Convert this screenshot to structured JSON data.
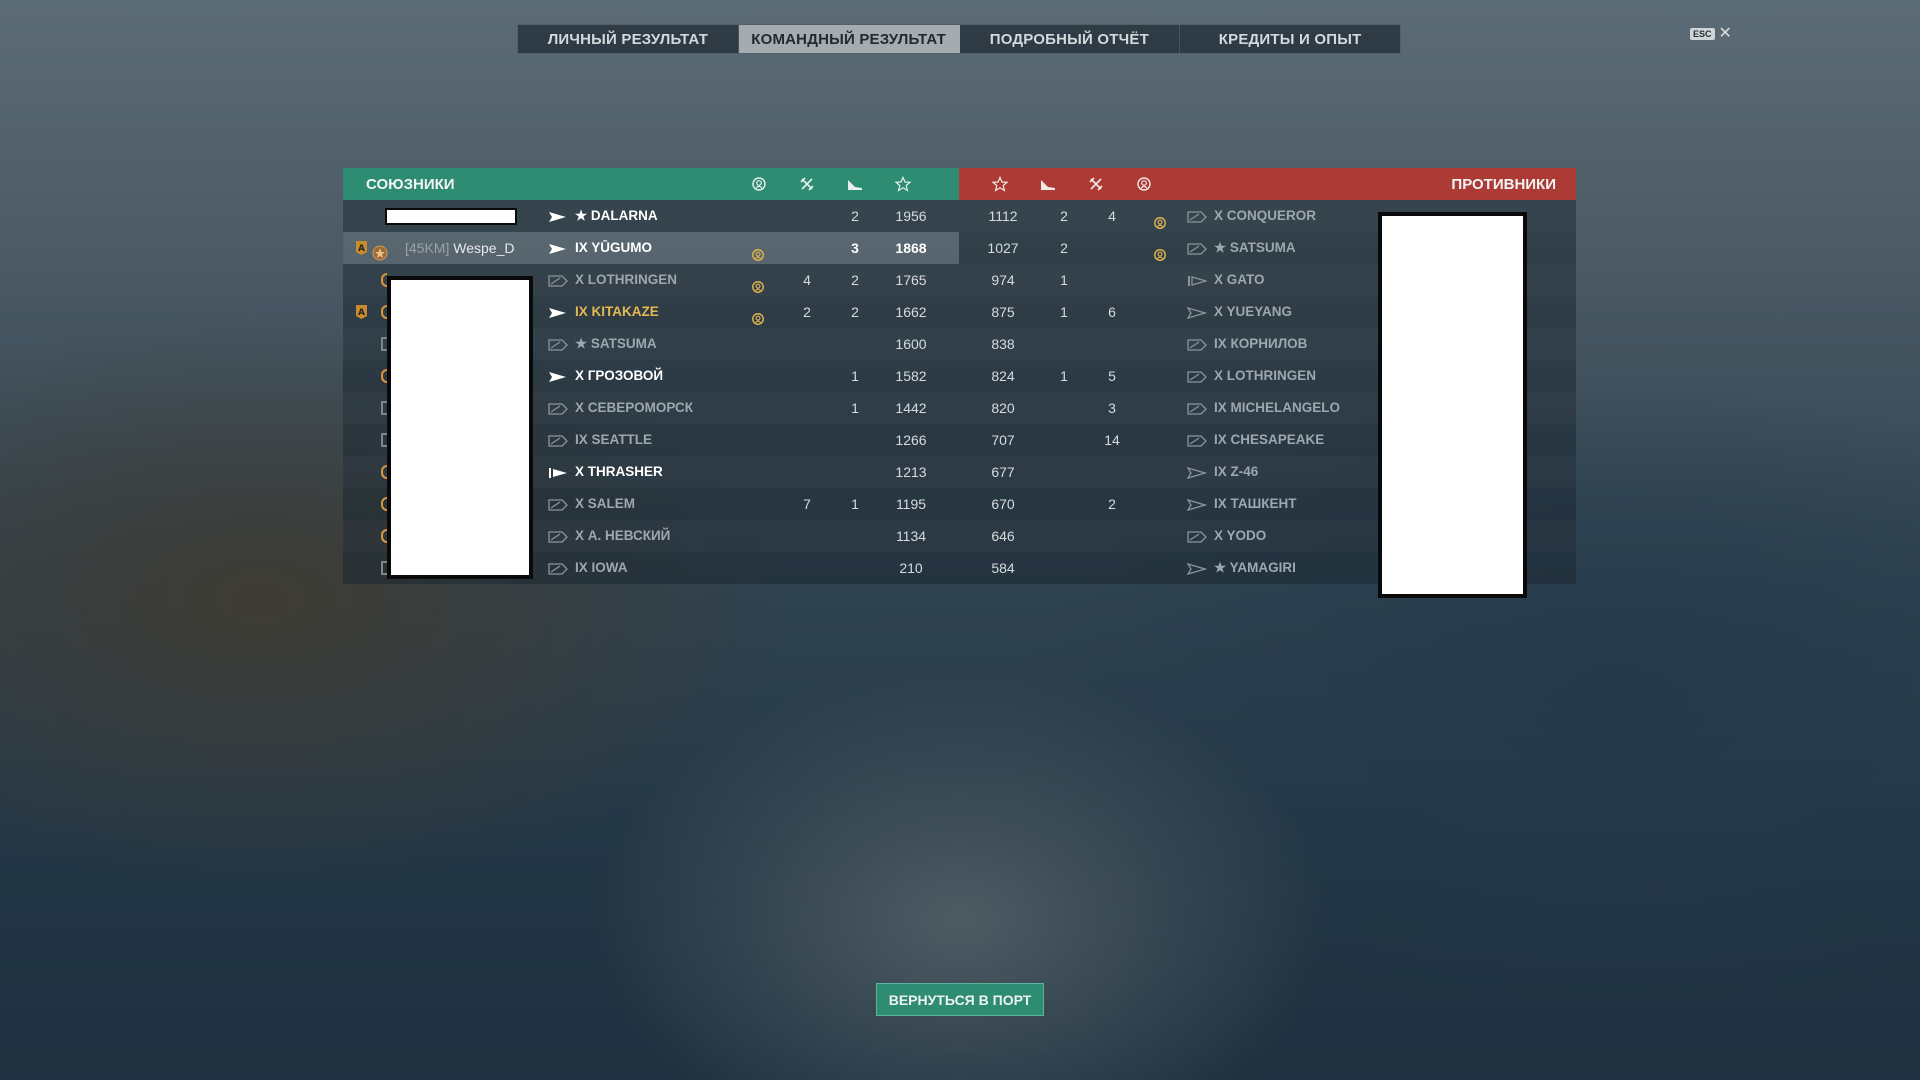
{
  "tabs": [
    {
      "label": "ЛИЧНЫЙ РЕЗУЛЬТАТ",
      "active": false
    },
    {
      "label": "КОМАНДНЫЙ РЕЗУЛЬТАТ",
      "active": true
    },
    {
      "label": "ПОДРОБНЫЙ ОТЧЁТ",
      "active": false
    },
    {
      "label": "КРЕДИТЫ И ОПЫТ",
      "active": false
    }
  ],
  "esc": {
    "key": "ESC",
    "close": "✕"
  },
  "allies": {
    "title": "СОЮЗНИКИ",
    "columns": [
      "laurel-icon",
      "crossed-swords-icon",
      "plane-icon",
      "star-icon"
    ],
    "rows": [
      {
        "player_clan": "",
        "player_name": "",
        "ship": "★ DALARNA",
        "ship_style": "alive",
        "ship_icon": "destroyer-white",
        "c1": "",
        "c2": "",
        "c3": "2",
        "score": "1956",
        "highlight": false
      },
      {
        "player_clan": "[45KM]",
        "player_name": "Wespe_D",
        "ship": "IX YŪGUMO",
        "ship_style": "alive",
        "ship_icon": "destroyer-white",
        "c1": "laurel",
        "c2": "",
        "c3": "3",
        "score": "1868",
        "highlight": true
      },
      {
        "player_clan": "",
        "player_name": "",
        "ship": "X LOTHRINGEN",
        "ship_style": "dim",
        "ship_icon": "battleship-grey",
        "c1": "laurel",
        "c2": "4",
        "c3": "2",
        "score": "1765",
        "highlight": false
      },
      {
        "player_clan": "",
        "player_name": "",
        "ship": "IX KITAKAZE",
        "ship_style": "gold",
        "ship_icon": "destroyer-white",
        "c1": "laurel",
        "c2": "2",
        "c3": "2",
        "score": "1662",
        "highlight": false
      },
      {
        "player_clan": "",
        "player_name": "",
        "ship": "★ SATSUMA",
        "ship_style": "dim",
        "ship_icon": "battleship-grey",
        "c1": "",
        "c2": "",
        "c3": "",
        "score": "1600",
        "highlight": false
      },
      {
        "player_clan": "",
        "player_name": "",
        "ship": "X ГРОЗОВОЙ",
        "ship_style": "alive",
        "ship_icon": "destroyer-white",
        "c1": "",
        "c2": "",
        "c3": "1",
        "score": "1582",
        "highlight": false
      },
      {
        "player_clan": "",
        "player_name": "",
        "ship": "X СЕВЕРОМОРСК",
        "ship_style": "dim",
        "ship_icon": "battleship-grey",
        "c1": "",
        "c2": "",
        "c3": "1",
        "score": "1442",
        "highlight": false
      },
      {
        "player_clan": "",
        "player_name": "",
        "ship": "IX SEATTLE",
        "ship_style": "dim",
        "ship_icon": "battleship-grey",
        "c1": "",
        "c2": "",
        "c3": "",
        "score": "1266",
        "highlight": false
      },
      {
        "player_clan": "",
        "player_name": "",
        "ship": "X THRASHER",
        "ship_style": "alive",
        "ship_icon": "submarine-white",
        "c1": "",
        "c2": "",
        "c3": "",
        "score": "1213",
        "highlight": false
      },
      {
        "player_clan": "",
        "player_name": "",
        "ship": "X SALEM",
        "ship_style": "dim",
        "ship_icon": "battleship-grey",
        "c1": "",
        "c2": "7",
        "c3": "1",
        "score": "1195",
        "highlight": false
      },
      {
        "player_clan": "",
        "player_name": "",
        "ship": "X А. НЕВСКИЙ",
        "ship_style": "dim",
        "ship_icon": "battleship-grey",
        "c1": "",
        "c2": "",
        "c3": "",
        "score": "1134",
        "highlight": false
      },
      {
        "player_clan": "",
        "player_name": "",
        "ship": "IX IOWA",
        "ship_style": "dim",
        "ship_icon": "battleship-grey",
        "c1": "",
        "c2": "",
        "c3": "",
        "score": "210",
        "highlight": false
      }
    ]
  },
  "enemies": {
    "title": "ПРОТИВНИКИ",
    "columns": [
      "star-icon",
      "plane-icon",
      "crossed-swords-icon",
      "laurel-icon"
    ],
    "rows": [
      {
        "score": "1112",
        "c3": "2",
        "c2": "4",
        "c1": "laurel",
        "ship": "X CONQUEROR",
        "ship_icon": "battleship-grey"
      },
      {
        "score": "1027",
        "c3": "2",
        "c2": "",
        "c1": "laurel",
        "ship": "★ SATSUMA",
        "ship_icon": "battleship-grey"
      },
      {
        "score": "974",
        "c3": "1",
        "c2": "",
        "c1": "",
        "ship": "X GATO",
        "ship_icon": "submarine-grey"
      },
      {
        "score": "875",
        "c3": "1",
        "c2": "6",
        "c1": "",
        "ship": "X YUEYANG",
        "ship_icon": "destroyer-grey"
      },
      {
        "score": "838",
        "c3": "",
        "c2": "",
        "c1": "",
        "ship": "IX КОРНИЛОВ",
        "ship_icon": "battleship-grey"
      },
      {
        "score": "824",
        "c3": "1",
        "c2": "5",
        "c1": "",
        "ship": "X LOTHRINGEN",
        "ship_icon": "battleship-grey"
      },
      {
        "score": "820",
        "c3": "",
        "c2": "3",
        "c1": "",
        "ship": "IX MICHELANGELO",
        "ship_icon": "battleship-grey"
      },
      {
        "score": "707",
        "c3": "",
        "c2": "14",
        "c1": "",
        "ship": "IX CHESAPEAKE",
        "ship_icon": "battleship-grey"
      },
      {
        "score": "677",
        "c3": "",
        "c2": "",
        "c1": "",
        "ship": "IX Z-46",
        "ship_icon": "destroyer-grey"
      },
      {
        "score": "670",
        "c3": "",
        "c2": "2",
        "c1": "",
        "ship": "IX ТАШКЕНТ",
        "ship_icon": "destroyer-grey"
      },
      {
        "score": "646",
        "c3": "",
        "c2": "",
        "c1": "",
        "ship": "X YODO",
        "ship_icon": "battleship-grey"
      },
      {
        "score": "584",
        "c3": "",
        "c2": "",
        "c1": "",
        "ship": "★ YAMAGIRI",
        "ship_icon": "destroyer-grey"
      }
    ]
  },
  "return_button": "ВЕРНУТЬСЯ В ПОРТ",
  "colors": {
    "ally": "#2e8c72",
    "enemy": "#ad3b35",
    "gold": "#e6b851"
  }
}
